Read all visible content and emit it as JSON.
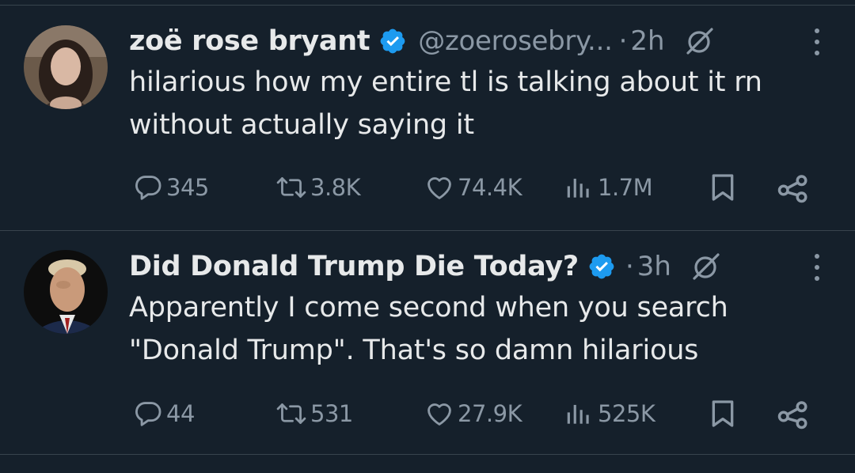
{
  "tweets": [
    {
      "display_name": "zoë rose bryant",
      "handle": "@zoerosebry...",
      "separator": "·",
      "time": "2h",
      "text": "hilarious how my entire tl is talking about it rn without actually saying it",
      "replies": "345",
      "retweets": "3.8K",
      "likes": "74.4K",
      "views": "1.7M",
      "verified": true,
      "avatar_colors": {
        "bg": "#6b5a4a",
        "face": "#d9b8a4",
        "hair": "#2a1f1a"
      }
    },
    {
      "display_name": "Did Donald Trump Die Today?",
      "handle": "",
      "separator": "·",
      "time": "3h",
      "text": "Apparently I come second when you search \"Donald Trump\". That's so damn hilarious",
      "replies": "44",
      "retweets": "531",
      "likes": "27.9K",
      "views": "525K",
      "verified": true,
      "avatar_colors": {
        "bg": "#0d0d0d",
        "face": "#c99a7a",
        "hair": "#d8c8a8"
      }
    }
  ],
  "icons": {
    "verified": "verified-badge-icon",
    "grok": "grok-icon",
    "more": "more-options-icon",
    "reply": "reply-icon",
    "retweet": "retweet-icon",
    "like": "like-icon",
    "views": "views-icon",
    "bookmark": "bookmark-icon",
    "share": "share-icon"
  },
  "colors": {
    "background": "#15202b",
    "text": "#e7e9ea",
    "muted": "#8b98a5",
    "verified_blue": "#1d9bf0",
    "divider": "#38444d"
  }
}
